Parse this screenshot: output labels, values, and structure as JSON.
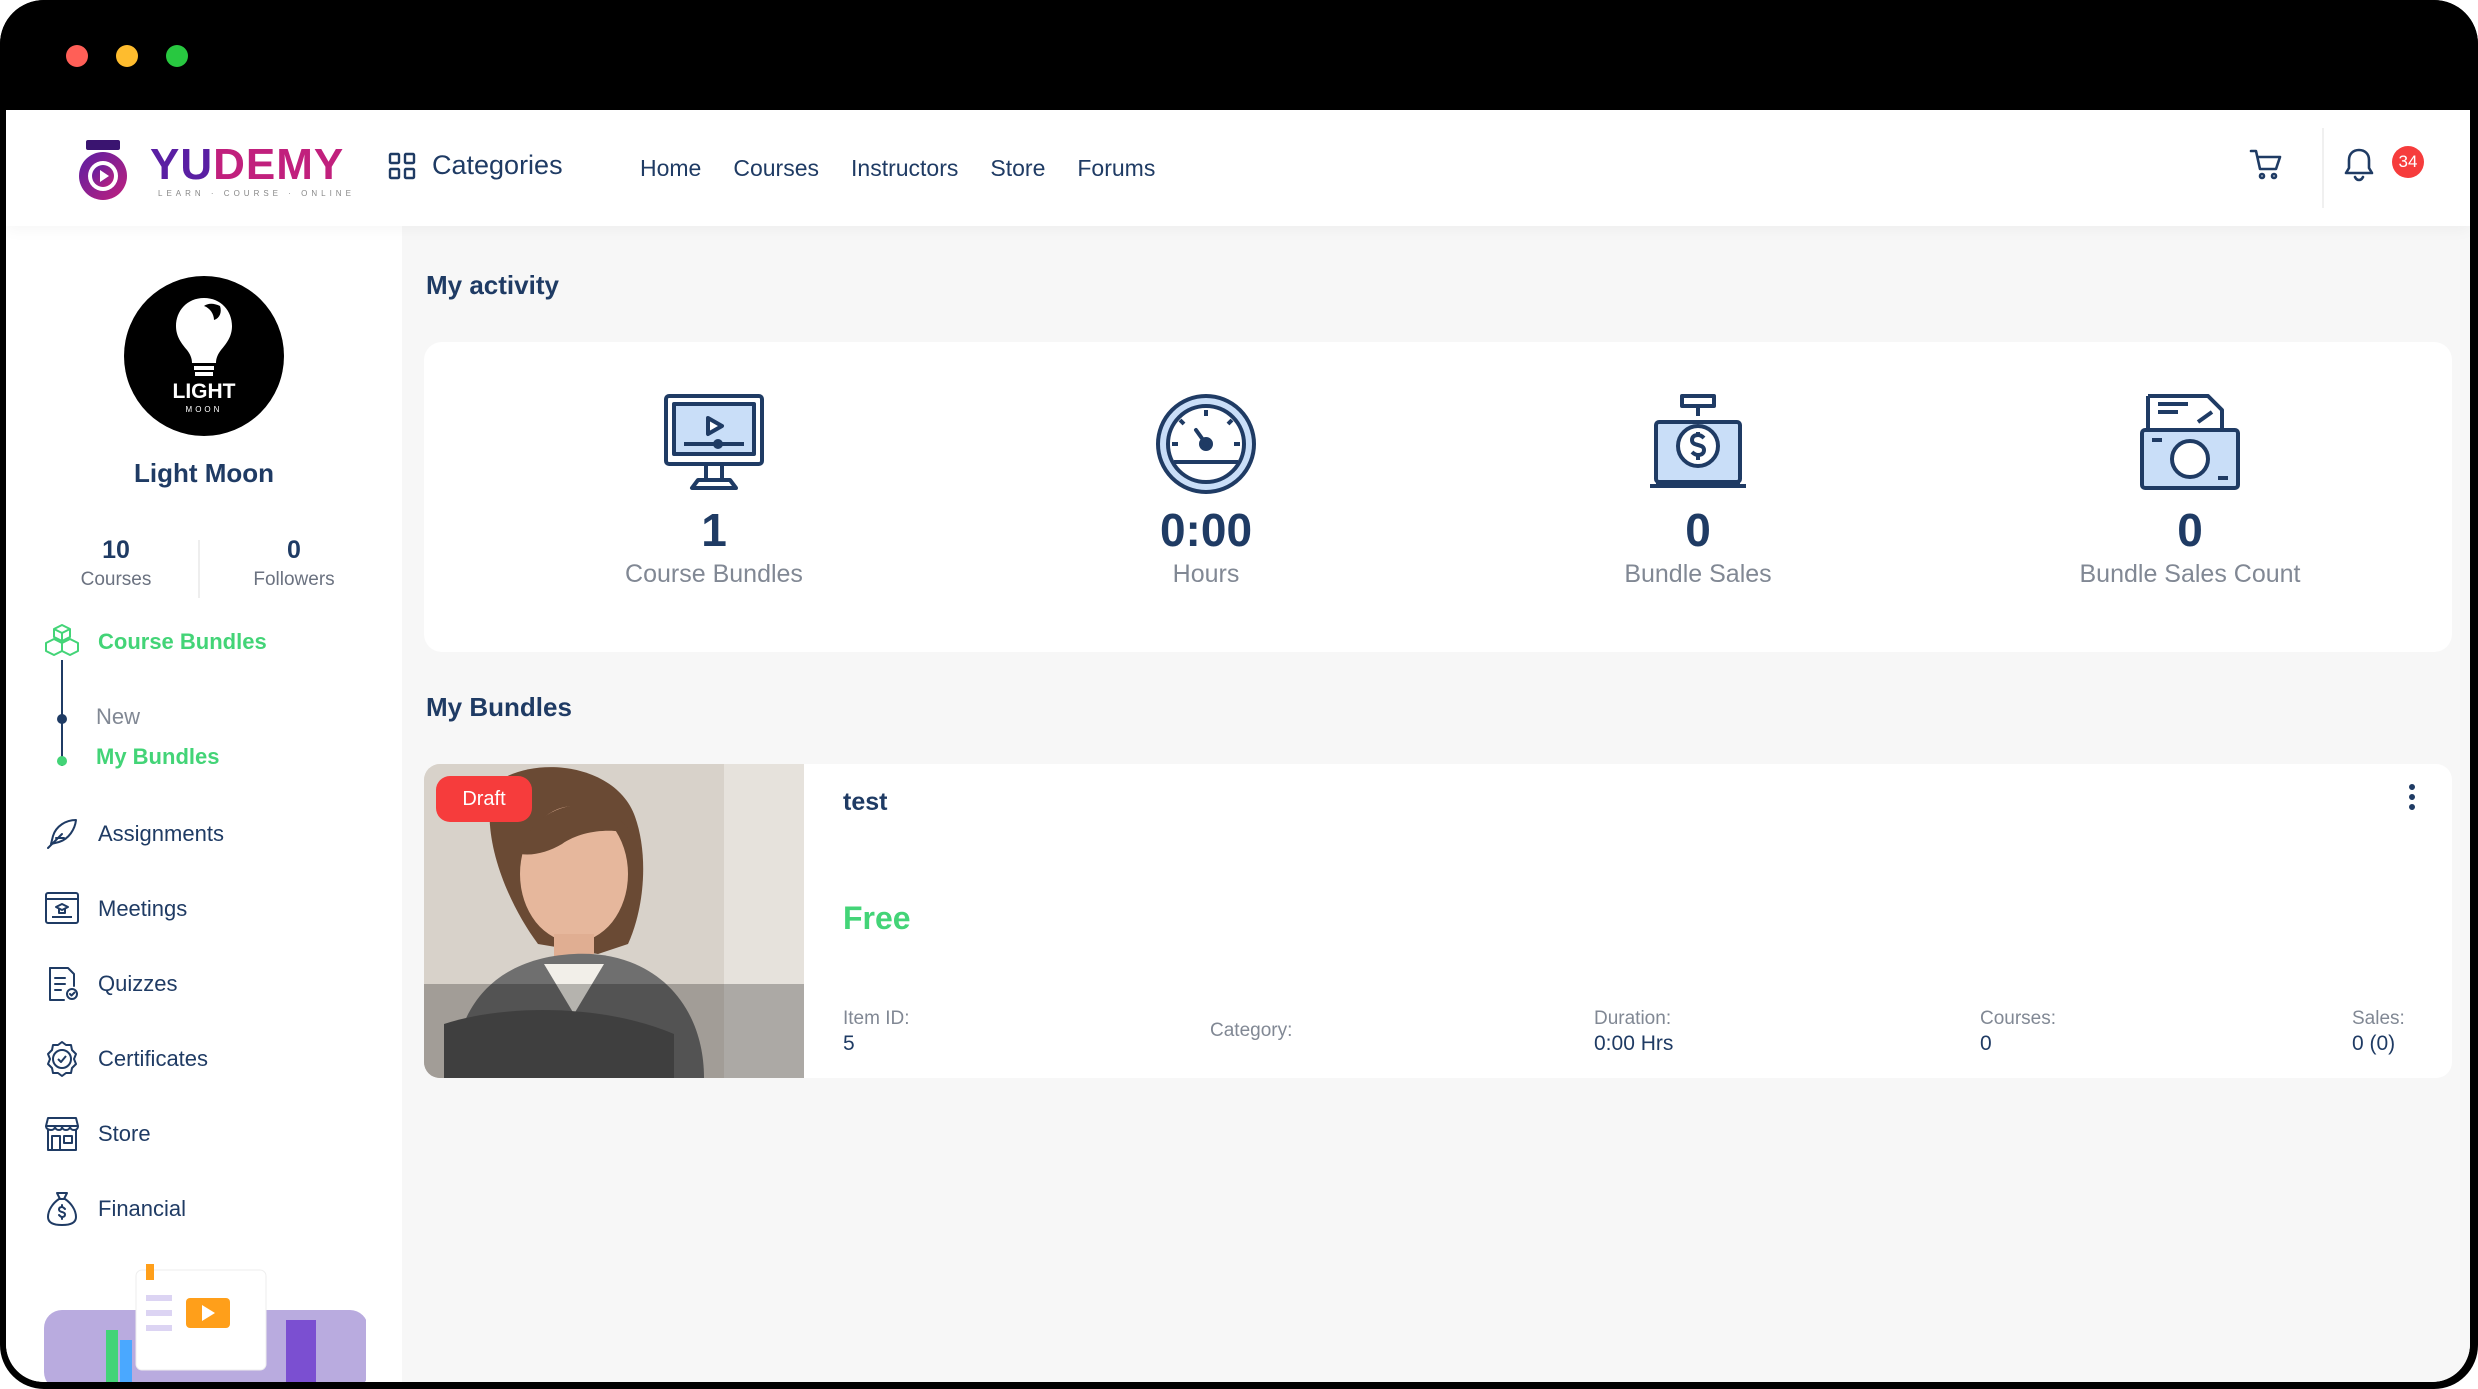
{
  "brand": {
    "logo_main": "YU",
    "logo_accent": "DEMY",
    "tagline": "LEARN · COURSE · ONLINE"
  },
  "nav": {
    "categories_label": "Categories",
    "links": [
      "Home",
      "Courses",
      "Instructors",
      "Store",
      "Forums"
    ],
    "notification_count": "34"
  },
  "profile": {
    "avatar_text": "LIGHT",
    "avatar_subtext": "MOON",
    "name": "Light Moon",
    "courses_count": "10",
    "courses_label": "Courses",
    "followers_count": "0",
    "followers_label": "Followers"
  },
  "sidebar": {
    "active_section": "Course Bundles",
    "sub_items": [
      "New",
      "My Bundles"
    ],
    "items": [
      {
        "label": "Assignments",
        "icon": "feather-icon"
      },
      {
        "label": "Meetings",
        "icon": "meeting-board-icon"
      },
      {
        "label": "Quizzes",
        "icon": "quiz-document-icon"
      },
      {
        "label": "Certificates",
        "icon": "certificate-badge-icon"
      },
      {
        "label": "Store",
        "icon": "store-icon"
      },
      {
        "label": "Financial",
        "icon": "money-bag-icon"
      }
    ]
  },
  "activity": {
    "title": "My activity",
    "cards": [
      {
        "value": "1",
        "label": "Course Bundles",
        "icon": "monitor-icon"
      },
      {
        "value": "0:00",
        "label": "Hours",
        "icon": "gauge-icon"
      },
      {
        "value": "0",
        "label": "Bundle Sales",
        "icon": "money-laptop-icon"
      },
      {
        "value": "0",
        "label": "Bundle Sales Count",
        "icon": "cash-icon"
      }
    ]
  },
  "bundles": {
    "title": "My Bundles",
    "items": [
      {
        "status": "Draft",
        "title": "test",
        "price": "Free",
        "item_id_label": "Item ID:",
        "item_id": "5",
        "category_label": "Category:",
        "category": "",
        "duration_label": "Duration:",
        "duration": "0:00 Hrs",
        "courses_label": "Courses:",
        "courses": "0",
        "sales_label": "Sales:",
        "sales": "0 (0)"
      }
    ]
  },
  "colors": {
    "primary": "#43d477",
    "navy": "#1f3b64",
    "danger": "#f63c3c",
    "muted": "#818894"
  }
}
